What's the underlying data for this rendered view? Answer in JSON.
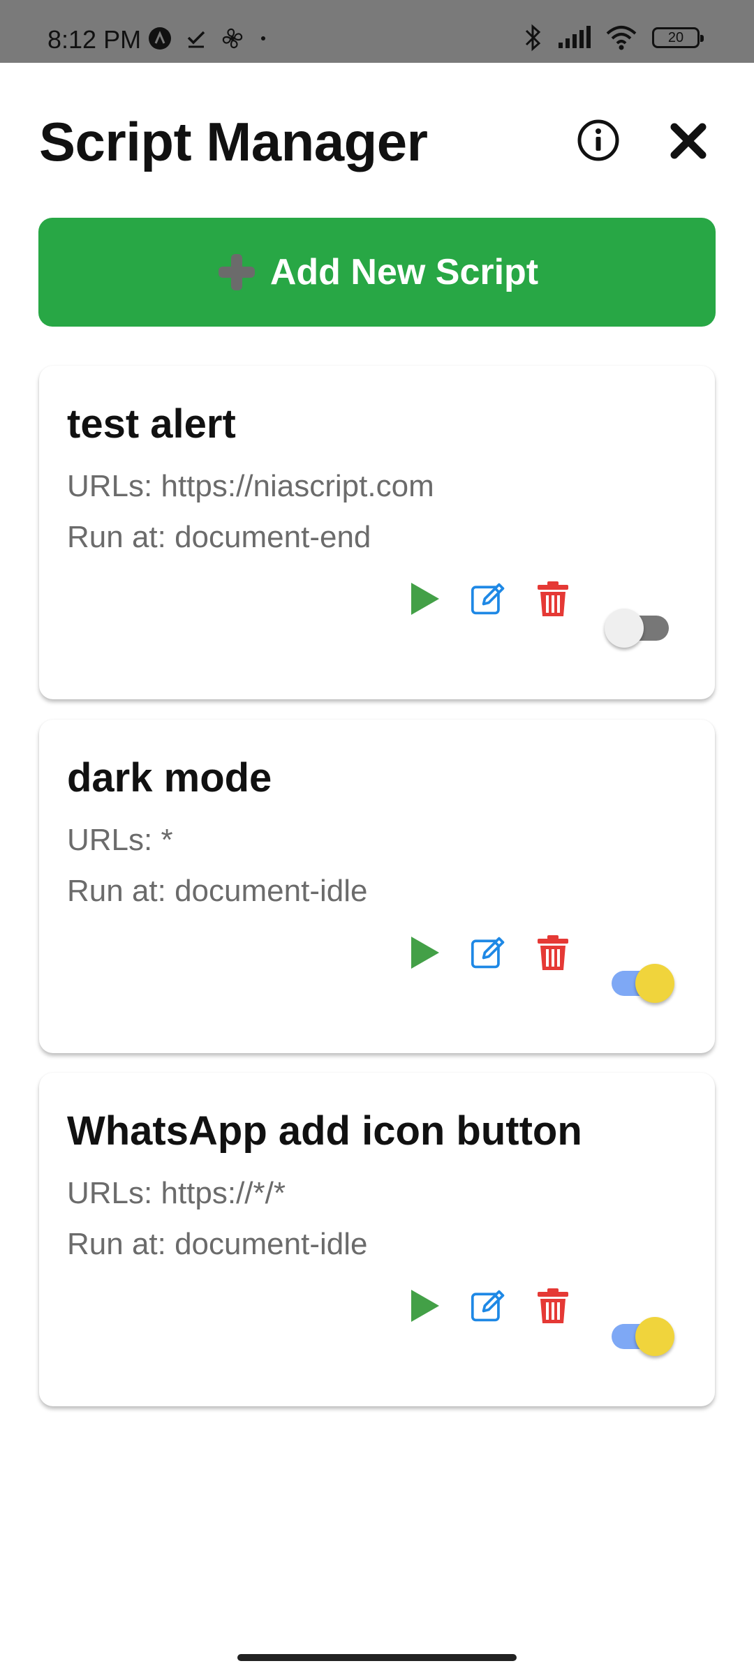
{
  "status_bar": {
    "time": "8:12 PM",
    "battery": "20",
    "left_icons": [
      "app-icon",
      "check-icon",
      "fan-icon",
      "dot-icon"
    ],
    "right_icons": [
      "bluetooth-icon",
      "signal-icon",
      "wifi-icon",
      "battery-icon"
    ]
  },
  "header": {
    "title": "Script Manager"
  },
  "add_button": {
    "label": "Add New Script",
    "color": "#28a745"
  },
  "scripts": [
    {
      "name": "test alert",
      "urls": "URLs: https://niascript.com",
      "run_at": "Run at: document-end",
      "enabled": false
    },
    {
      "name": "dark mode",
      "urls": "URLs: *",
      "run_at": "Run at: document-idle",
      "enabled": true
    },
    {
      "name": "WhatsApp add icon button",
      "urls": "URLs: https://*/*",
      "run_at": "Run at: document-idle",
      "enabled": true
    }
  ],
  "colors": {
    "play": "#43a047",
    "edit": "#1e88e5",
    "delete": "#e53935",
    "toggle_on_track": "#7ea8f5",
    "toggle_on_thumb": "#f0d43c"
  }
}
